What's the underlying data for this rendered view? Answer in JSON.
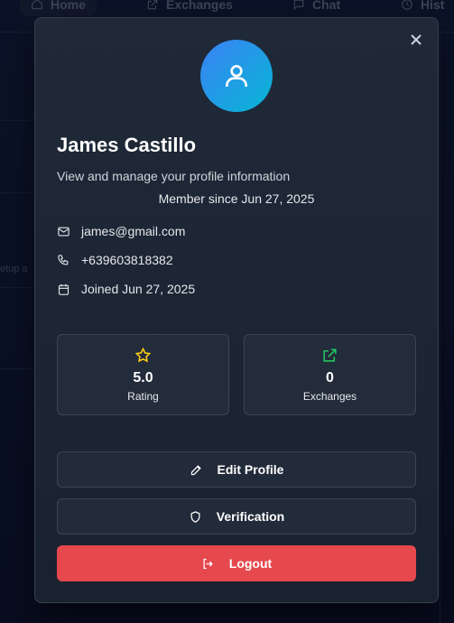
{
  "background_nav": {
    "items": [
      "Home",
      "Exchanges",
      "Chat",
      "Hist"
    ]
  },
  "background_snippet": "etup a",
  "profile": {
    "name": "James Castillo",
    "subtitle": "View and manage your profile information",
    "member_since": "Member since Jun 27, 2025",
    "email": "james@gmail.com",
    "phone": "+639603818382",
    "joined": "Joined Jun 27, 2025"
  },
  "stats": [
    {
      "value": "5.0",
      "label": "Rating",
      "icon": "star-icon",
      "color": "#facc15"
    },
    {
      "value": "0",
      "label": "Exchanges",
      "icon": "external-link-icon",
      "color": "#22c55e"
    }
  ],
  "actions": {
    "edit_profile": "Edit Profile",
    "verification": "Verification",
    "logout": "Logout"
  },
  "colors": {
    "avatar_gradient_start": "#3b82f6",
    "avatar_gradient_end": "#06b6d4",
    "logout_bg": "#e5484d"
  }
}
